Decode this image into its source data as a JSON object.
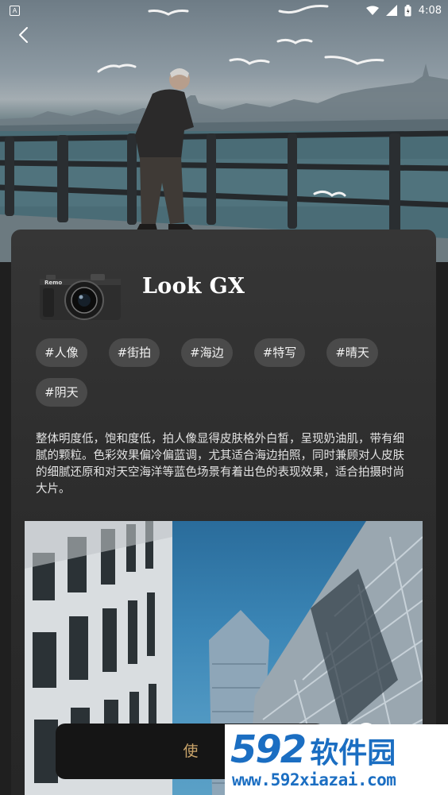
{
  "status_bar": {
    "notification_letter": "A",
    "time": "4:08",
    "icons": [
      "wifi-icon",
      "signal-icon",
      "battery-icon"
    ]
  },
  "nav": {
    "back_icon": "chevron-left-icon"
  },
  "look": {
    "title": "Look GX",
    "camera_brand": "Remo",
    "tags": [
      "#人像",
      "#街拍",
      "#海边",
      "#特写",
      "#晴天",
      "#阴天"
    ],
    "description": "整体明度低，饱和度低，拍人像显得皮肤格外白皙，呈现奶油肌，带有细腻的颗粒。色彩效果偏冷偏蓝调，尤其适合海边拍照，同时兼顾对人皮肤的细腻还原和对天空海洋等蓝色场景有着出色的表现效果，适合拍摄时尚大片。"
  },
  "action": {
    "use_label": "使"
  },
  "watermark": {
    "number": "592",
    "name": "软件园",
    "url": "www.592xiazai.com"
  },
  "colors": {
    "accent": "#c9a46a",
    "tag_bg": "#4a4a4a",
    "card_bg": "#333333",
    "watermark_blue": "#1b6ec2"
  }
}
